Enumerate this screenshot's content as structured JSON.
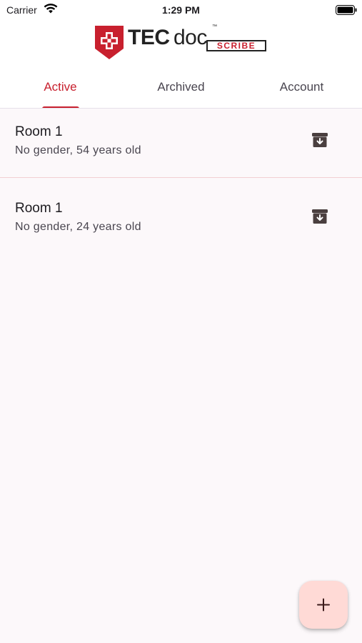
{
  "status_bar": {
    "carrier": "Carrier",
    "time": "1:29 PM"
  },
  "logo": {
    "brand_bold": "TEC",
    "brand_light": "doc",
    "trademark": "™",
    "product": "SCRIBE",
    "brand_color": "#c8202e"
  },
  "tabs": [
    {
      "label": "Active",
      "selected": true
    },
    {
      "label": "Archived",
      "selected": false
    },
    {
      "label": "Account",
      "selected": false
    }
  ],
  "patients": [
    {
      "room": "Room 1",
      "details": "No gender, 54 years old",
      "action_icon": "archive-icon"
    },
    {
      "room": "Room 1",
      "details": "No gender, 24 years old",
      "action_icon": "archive-icon"
    }
  ],
  "fab": {
    "icon": "plus-icon",
    "label": "+"
  },
  "colors": {
    "accent": "#c8202e",
    "background": "#fcf8fa",
    "fab_background": "#ffdad6",
    "icon": "#4a3f3f"
  }
}
